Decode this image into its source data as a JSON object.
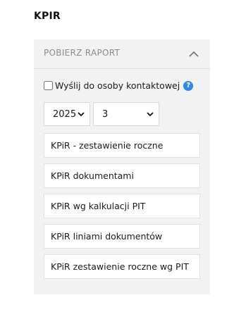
{
  "page": {
    "title": "KPIR"
  },
  "panel": {
    "header_label": "POBIERZ RAPORT",
    "header_icon": "chevron-up-icon",
    "send_to_contact_label": "Wyślij do osoby kontaktowej",
    "send_to_contact_checked": false,
    "help_icon_glyph": "?",
    "year": {
      "selected": "2025"
    },
    "month": {
      "selected": "3"
    },
    "reports": [
      {
        "label": "KPiR - zestawienie roczne"
      },
      {
        "label": "KPiR dokumentami"
      },
      {
        "label": "KPiR wg kalkulacji PIT"
      },
      {
        "label": "KPiR liniami dokumentów"
      },
      {
        "label": "KPiR zestawienie roczne wg PIT"
      }
    ],
    "colors": {
      "panel_bg": "#f2f2f2",
      "help_icon": "#2f8be6",
      "header_text": "#8a8a8a"
    }
  }
}
